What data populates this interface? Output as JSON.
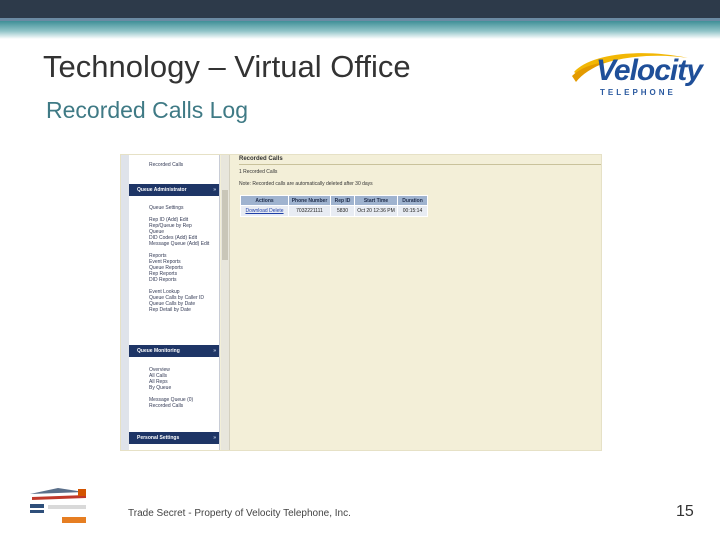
{
  "slide": {
    "title": "Technology – Virtual Office",
    "subtitle": "Recorded Calls Log",
    "footer": "Trade Secret - Property of Velocity Telephone, Inc.",
    "page_number": "15"
  },
  "logo": {
    "word": "Velocity",
    "sub": "TELEPHONE"
  },
  "footer_logo": {
    "text": ""
  },
  "screenshot": {
    "sidebar": {
      "top_item": "Recorded Calls",
      "queue_admin_header": "Queue Administrator",
      "queue_admin_items": [
        "Queue Settings",
        "",
        "Rep ID (Add) Edit",
        "Rep/Queue by Rep",
        "Queue",
        "DID Codes (Add) Edit",
        "Message Queue (Add) Edit",
        "",
        "Reports",
        "Event Reports",
        "Queue Reports",
        "Rep Reports",
        "DID Reports",
        "",
        "Event Lookup",
        "Queue Calls by Caller ID",
        "Queue Calls by Date",
        "Rep Detail by Date"
      ],
      "queue_monitoring_header": "Queue Monitoring",
      "queue_monitoring_items": [
        "Overview",
        "All Calls",
        "All Reps",
        "By Queue",
        "",
        "Message Queue (0)",
        "Recorded Calls"
      ],
      "personal_settings_header": "Personal Settings"
    },
    "content": {
      "title": "Recorded Calls",
      "line1": "1 Recorded Calls",
      "note": "Note: Recorded calls are automatically deleted after 30 days",
      "columns": [
        "Actions",
        "Phone Number",
        "Rep ID",
        "Start Time",
        "Duration"
      ],
      "rows": [
        {
          "actions": "Download Delete",
          "phone": "7032221111",
          "rep_id": "5830",
          "start": "Oct 20 12:36 PM",
          "duration": "00:15:14"
        }
      ]
    }
  }
}
